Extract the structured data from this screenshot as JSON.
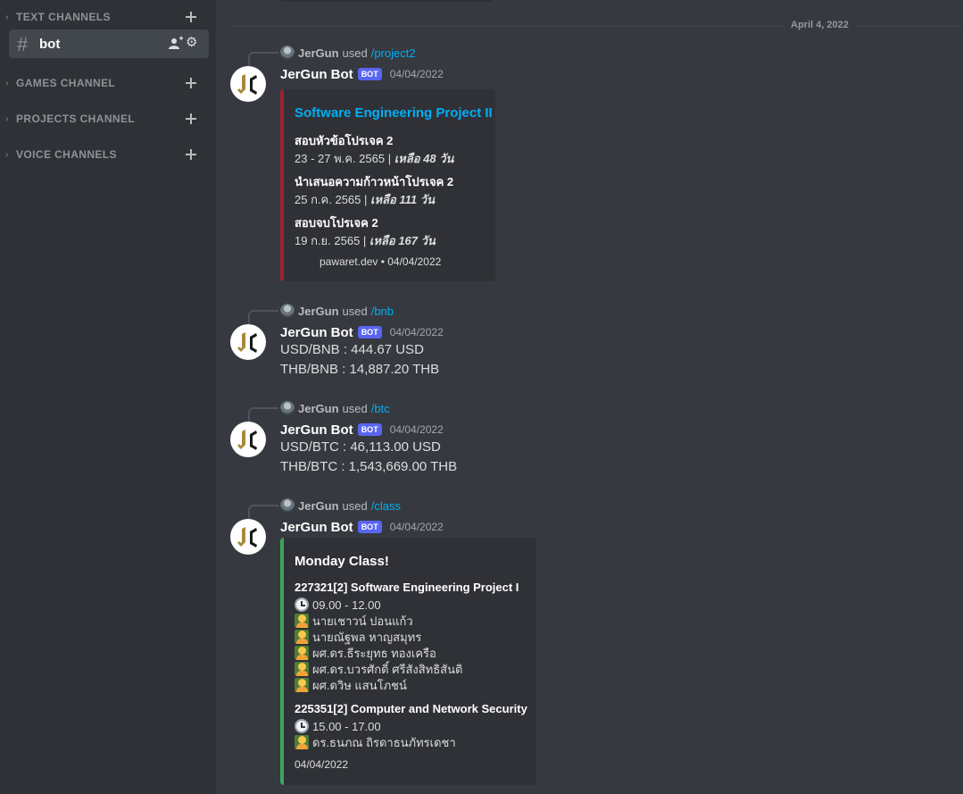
{
  "colors": {
    "accent": "#5865f2",
    "link": "#00aff4",
    "embed_red": "#9b2335",
    "embed_green": "#3ba55c",
    "embed_title_blue": "#00aff4"
  },
  "sidebar": {
    "categories": [
      {
        "label": "TEXT CHANNELS",
        "icon": "chevron-right-icon"
      },
      {
        "label": "GAMES CHANNEL",
        "icon": "chevron-right-icon"
      },
      {
        "label": "PROJECTS CHANNEL",
        "icon": "chevron-right-icon"
      },
      {
        "label": "VOICE CHANNELS",
        "icon": "chevron-right-icon"
      }
    ],
    "channel": {
      "name": "bot",
      "icon": "hash-icon"
    }
  },
  "main": {
    "date_divider": "April 4, 2022",
    "messages": [
      {
        "reply_user": "JerGun",
        "reply_used": "used",
        "command": "/project2",
        "author": "JerGun Bot",
        "badge": "BOT",
        "timestamp": "04/04/2022",
        "embed": {
          "title": "Software Engineering Project II",
          "fields": [
            {
              "name": "สอบหัวข้อโปรเจค 2",
              "value": "23 - 27 พ.ค. 2565 | ",
              "remaining": "เหลือ 48 วัน"
            },
            {
              "name": "นำเสนอความก้าวหน้าโปรเจค 2",
              "value": "25 ก.ค. 2565 | ",
              "remaining": "เหลือ 111 วัน"
            },
            {
              "name": "สอบจบโปรเจค 2",
              "value": "19 ก.ย. 2565 | ",
              "remaining": "เหลือ 167 วัน"
            }
          ],
          "footer": "pawaret.dev • 04/04/2022"
        }
      },
      {
        "reply_user": "JerGun",
        "reply_used": "used",
        "command": "/bnb",
        "author": "JerGun Bot",
        "badge": "BOT",
        "timestamp": "04/04/2022",
        "lines": [
          "USD/BNB : 444.67 USD",
          "THB/BNB : 14,887.20 THB"
        ]
      },
      {
        "reply_user": "JerGun",
        "reply_used": "used",
        "command": "/btc",
        "author": "JerGun Bot",
        "badge": "BOT",
        "timestamp": "04/04/2022",
        "lines": [
          "USD/BTC : 46,113.00 USD",
          "THB/BTC : 1,543,669.00 THB"
        ]
      },
      {
        "reply_user": "JerGun",
        "reply_used": "used",
        "command": "/class",
        "author": "JerGun Bot",
        "badge": "BOT",
        "timestamp": "04/04/2022",
        "embed": {
          "title": "Monday Class!",
          "courses": [
            {
              "name": "227321[2] Software Engineering Project I",
              "time": "09.00 - 12.00",
              "teachers": [
                "นายเชาวน์ ปอนแก้ว",
                "นายณัฐพล หาญสมุทร",
                "ผศ.ดร.ธีระยุทธ ทองเครือ",
                "ผศ.ดร.บวรศักดิ์ ศรีสังสิทธิสันติ",
                "ผศ.ดวิษ แสนโภชน์"
              ]
            },
            {
              "name": "225351[2] Computer and Network Security",
              "time": "15.00 - 17.00",
              "teachers": [
                "ดร.ธนภณ ถิรดาธนภัทรเดชา"
              ]
            }
          ],
          "footer": "04/04/2022"
        }
      }
    ]
  }
}
